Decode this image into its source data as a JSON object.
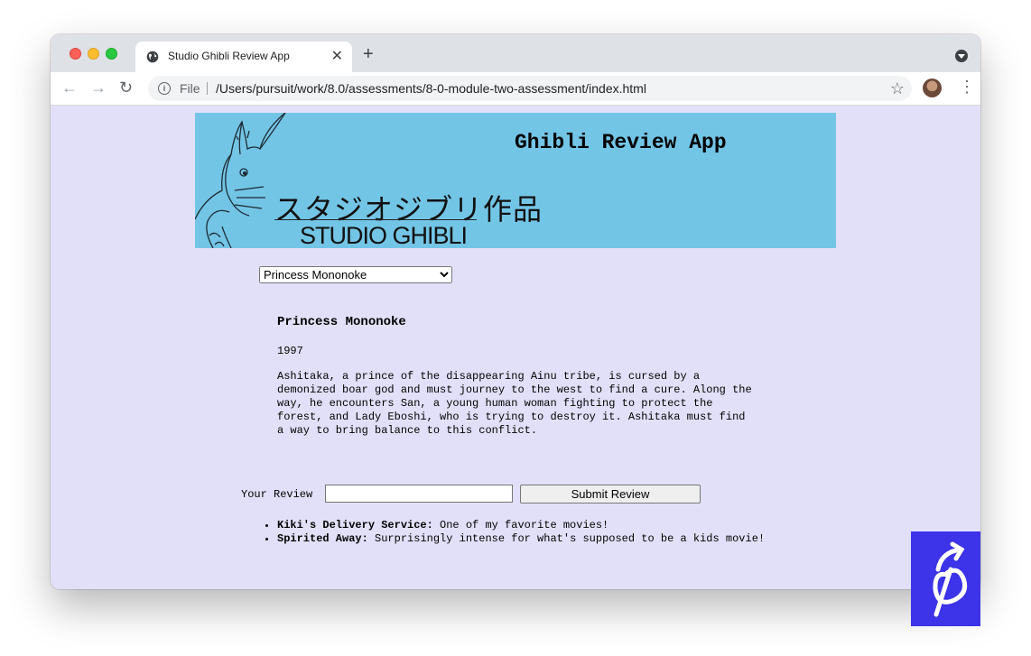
{
  "browser": {
    "tab_title": "Studio Ghibli Review App",
    "scheme_label": "File",
    "url": "/Users/pursuit/work/8.0/assessments/8-0-module-two-assessment/index.html"
  },
  "banner": {
    "title": "Ghibli Review App",
    "logo_japanese": "スタジオジブリ作品",
    "logo_english": "STUDIO GHIBLI"
  },
  "movie_select": {
    "selected": "Princess Mononoke"
  },
  "movie": {
    "title": "Princess Mononoke",
    "year": "1997",
    "description": "Ashitaka, a prince of the disappearing Ainu tribe, is cursed by a demonized boar god and must journey to the west to find a cure. Along the way, he encounters San, a young human woman fighting to protect the forest, and Lady Eboshi, who is trying to destroy it. Ashitaka must find a way to bring balance to this conflict."
  },
  "review_form": {
    "label": "Your Review",
    "value": "",
    "submit_label": "Submit Review"
  },
  "reviews": [
    {
      "movie": "Kiki's Delivery Service:",
      "text": " One of my favorite movies!"
    },
    {
      "movie": "Spirited Away:",
      "text": " Surprisingly intense for what's supposed to be a kids movie!"
    }
  ],
  "colors": {
    "page_background": "#e2e0f8",
    "banner_background": "#73c5e6",
    "badge": "#3d33e8"
  },
  "icons": [
    "globe-icon",
    "close-icon",
    "plus-icon",
    "back-arrow-icon",
    "forward-arrow-icon",
    "reload-icon",
    "info-icon",
    "star-icon",
    "avatar",
    "menu-dots-icon",
    "loom-logo-icon"
  ]
}
